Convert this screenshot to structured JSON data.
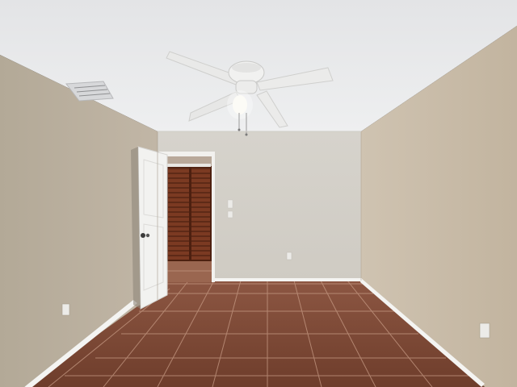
{
  "photo": {
    "subject": "empty-bedroom",
    "watermark_text": "",
    "colors": {
      "ceiling": "#e9eaec",
      "wall_left": "#b8ad9d",
      "wall_back": "#d3d0c8",
      "wall_right": "#c7baa6",
      "floor_tile": "#7a4732",
      "grout": "#c9a08a",
      "baseboard": "#f4f4f2",
      "door": "#f2f2f0",
      "closet_wood": "#7b3a22",
      "fan": "#eeeeee"
    }
  }
}
